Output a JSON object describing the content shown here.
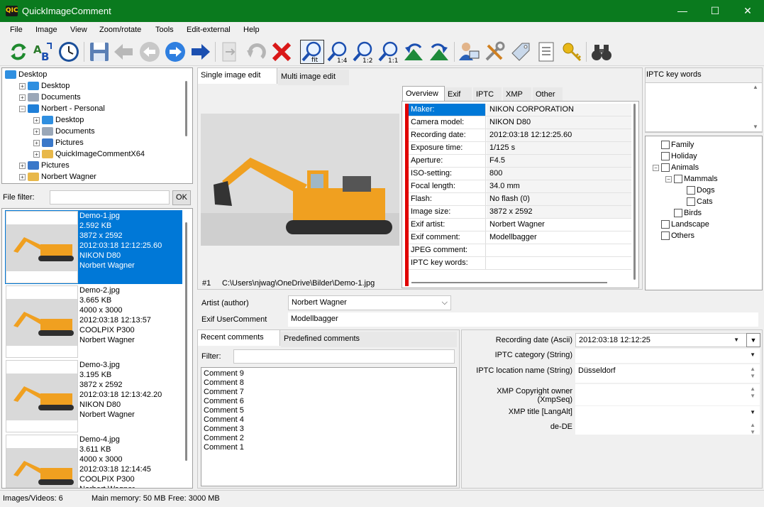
{
  "window": {
    "title": "QuickImageComment",
    "icon_text": "QIC",
    "minimize": "—",
    "maximize": "☐",
    "close": "✕"
  },
  "menu": [
    "File",
    "Image",
    "View",
    "Zoom/rotate",
    "Tools",
    "Edit-external",
    "Help"
  ],
  "toolbar": {
    "icons": [
      "refresh-icon",
      "rename-icon",
      "clock-icon",
      "save-icon",
      "back-gray-icon",
      "circle-back-icon",
      "circle-forward-icon",
      "forward-icon",
      "next-gray-icon",
      "undo-gray-icon",
      "delete-icon",
      "zoom-fit-icon",
      "zoom-1-4-icon",
      "zoom-1-2-icon",
      "zoom-1-1-icon",
      "rotate-left-icon",
      "rotate-right-icon",
      "user-settings-icon",
      "tools-icon",
      "tag-icon",
      "document-icon",
      "key-icon",
      "binoculars-icon"
    ],
    "zoom_fit": "fit",
    "zoom_14": "1:4",
    "zoom_12": "1:2",
    "zoom_11": "1:1"
  },
  "folder_tree": [
    {
      "label": "Desktop",
      "icon": "desktop",
      "level": 0,
      "exp": ""
    },
    {
      "label": "Desktop",
      "icon": "desktop",
      "level": 1,
      "exp": "+"
    },
    {
      "label": "Documents",
      "icon": "documents",
      "level": 1,
      "exp": "+"
    },
    {
      "label": "Norbert - Personal",
      "icon": "cloud",
      "level": 1,
      "exp": "−"
    },
    {
      "label": "Desktop",
      "icon": "desktop",
      "level": 2,
      "exp": "+"
    },
    {
      "label": "Documents",
      "icon": "documents",
      "level": 2,
      "exp": "+"
    },
    {
      "label": "Pictures",
      "icon": "pictures",
      "level": 2,
      "exp": "+"
    },
    {
      "label": "QuickImageCommentX64",
      "icon": "folder",
      "level": 2,
      "exp": "+"
    },
    {
      "label": "Pictures",
      "icon": "pictures",
      "level": 1,
      "exp": "+"
    },
    {
      "label": "Norbert Wagner",
      "icon": "folder",
      "level": 1,
      "exp": "+"
    }
  ],
  "file_filter": {
    "label": "File filter:",
    "value": "",
    "ok": "OK"
  },
  "thumbnails": [
    {
      "lines": [
        "Demo-1.jpg",
        "2.592 KB",
        "3872 x 2592",
        "2012:03:18 12:12:25.60",
        "NIKON D80",
        "Norbert Wagner"
      ],
      "selected": true
    },
    {
      "lines": [
        "Demo-2.jpg",
        "3.665 KB",
        "4000 x 3000",
        "2012:03:18 12:13:57",
        "COOLPIX P300",
        "Norbert Wagner"
      ],
      "selected": false
    },
    {
      "lines": [
        "Demo-3.jpg",
        "3.195 KB",
        "3872 x 2592",
        "2012:03:18 12:13:42.20",
        "NIKON D80",
        "Norbert Wagner"
      ],
      "selected": false
    },
    {
      "lines": [
        "Demo-4.jpg",
        "3.611 KB",
        "4000 x 3000",
        "2012:03:18 12:14:45",
        "COOLPIX P300",
        "Norbert Wagner"
      ],
      "selected": false
    }
  ],
  "edit_tabs": [
    "Single image edit",
    "Multi image edit"
  ],
  "image_caption": {
    "index": "#1",
    "path": "C:\\Users\\njwag\\OneDrive\\Bilder\\Demo-1.jpg"
  },
  "meta_tabs": [
    "Overview",
    "Exif",
    "IPTC",
    "XMP",
    "Other"
  ],
  "meta_rows": [
    {
      "key": "Maker:",
      "value": "NIKON CORPORATION"
    },
    {
      "key": "Camera model:",
      "value": "NIKON D80"
    },
    {
      "key": "Recording date:",
      "value": "2012:03:18 12:12:25.60"
    },
    {
      "key": "Exposure time:",
      "value": "1/125 s"
    },
    {
      "key": "Aperture:",
      "value": "F4.5"
    },
    {
      "key": "ISO-setting:",
      "value": "800"
    },
    {
      "key": "Focal length:",
      "value": "34.0 mm"
    },
    {
      "key": "Flash:",
      "value": "No flash (0)"
    },
    {
      "key": "Image size:",
      "value": "3872 x 2592"
    },
    {
      "key": "Exif artist:",
      "value": "Norbert Wagner"
    },
    {
      "key": "Exif comment:",
      "value": "Modellbagger"
    },
    {
      "key": "JPEG comment:",
      "value": ""
    },
    {
      "key": "IPTC key words:",
      "value": ""
    }
  ],
  "iptc_keywords": {
    "label": "IPTC key words"
  },
  "keyword_tree": [
    {
      "label": "Family",
      "level": 0,
      "exp": ""
    },
    {
      "label": "Holiday",
      "level": 0,
      "exp": ""
    },
    {
      "label": "Animals",
      "level": 0,
      "exp": "−"
    },
    {
      "label": "Mammals",
      "level": 1,
      "exp": "−"
    },
    {
      "label": "Dogs",
      "level": 2,
      "exp": ""
    },
    {
      "label": "Cats",
      "level": 2,
      "exp": ""
    },
    {
      "label": "Birds",
      "level": 1,
      "exp": ""
    },
    {
      "label": "Landscape",
      "level": 0,
      "exp": ""
    },
    {
      "label": "Others",
      "level": 0,
      "exp": ""
    }
  ],
  "artist": {
    "label": "Artist (author)",
    "value": "Norbert Wagner"
  },
  "user_comment": {
    "label": "Exif UserComment",
    "value": "Modellbagger"
  },
  "comment_tabs": [
    "Recent comments",
    "Predefined comments"
  ],
  "comment_filter": {
    "label": "Filter:",
    "value": ""
  },
  "comments": [
    "Comment 9",
    "Comment 8",
    "Comment 7",
    "Comment 6",
    "Comment 5",
    "Comment 4",
    "Comment 3",
    "Comment 2",
    "Comment 1"
  ],
  "right_fields": [
    {
      "label": "Recording date (Ascii)",
      "value": "2012:03:18 12:12:25",
      "control": "combo"
    },
    {
      "label": "IPTC category (String)",
      "value": "",
      "control": "combo"
    },
    {
      "label": "IPTC location name (String)",
      "value": "Düsseldorf",
      "control": "multiline"
    },
    {
      "label": "XMP Copyright owner (XmpSeq)",
      "value": "",
      "control": "multiline"
    },
    {
      "label": "XMP title [LangAlt]",
      "value": "",
      "control": "combo"
    },
    {
      "label": "de-DE",
      "value": "",
      "control": "multiline"
    }
  ],
  "status": {
    "images": "Images/Videos: 6",
    "memory": "Main memory: 50 MB",
    "free": "Free: 3000 MB"
  },
  "colors": {
    "title_bar": "#0a7a1e",
    "selection": "#0078d7",
    "accent_red": "#e00000"
  }
}
